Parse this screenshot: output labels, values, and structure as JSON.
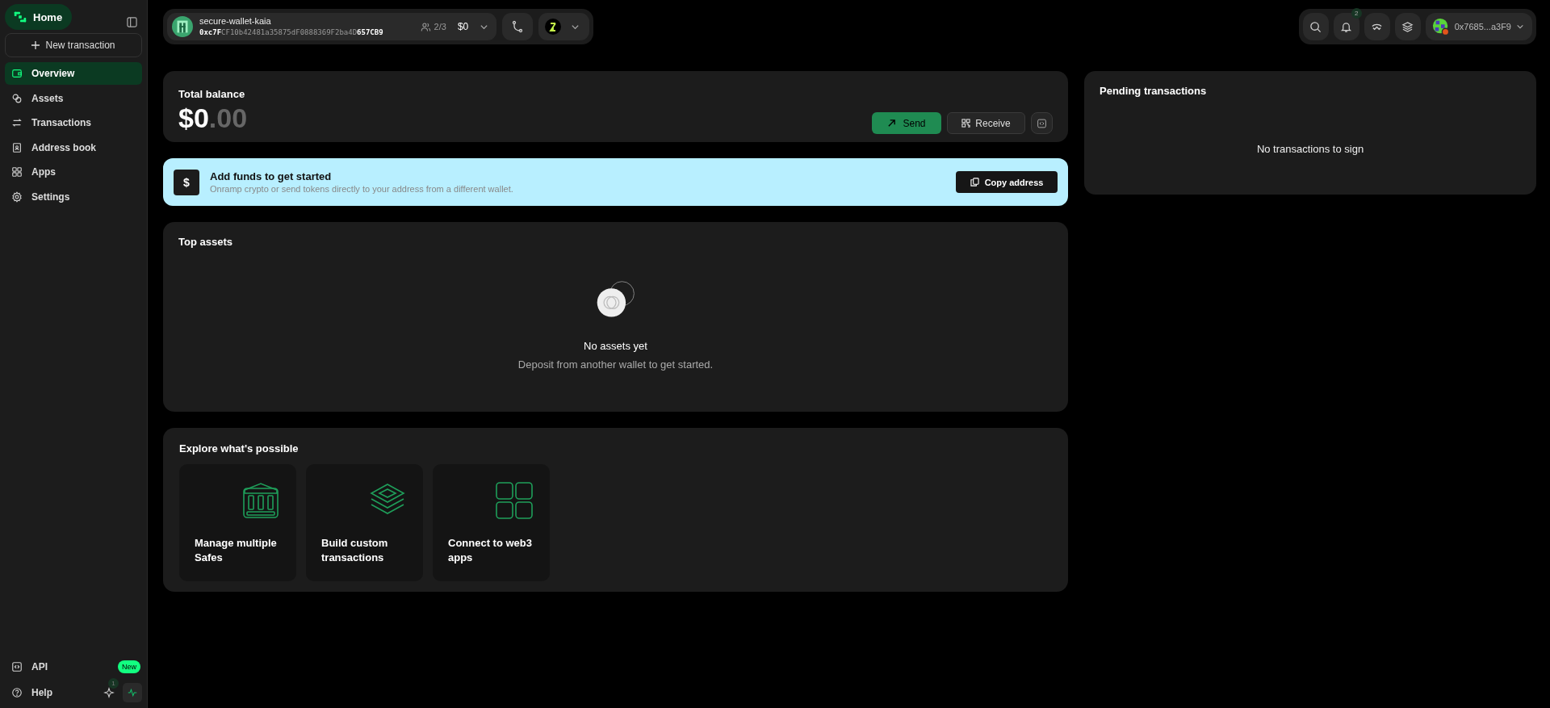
{
  "sidebar": {
    "home": "Home",
    "new_transaction": "New transaction",
    "items": [
      {
        "label": "Overview",
        "selected": true
      },
      {
        "label": "Assets",
        "selected": false
      },
      {
        "label": "Transactions",
        "selected": false
      },
      {
        "label": "Address book",
        "selected": false
      },
      {
        "label": "Apps",
        "selected": false
      },
      {
        "label": "Settings",
        "selected": false
      }
    ],
    "api": {
      "label": "API",
      "badge": "New"
    },
    "help": {
      "label": "Help",
      "badge": "1"
    }
  },
  "header": {
    "safe_name": "secure-wallet-kaia",
    "safe_address": "**0xc7F**CF10b42481a35875dF0888369F2ba4D**657CB9**",
    "threshold": "2/3",
    "balance": "$0",
    "notifications": "2",
    "account": "0x7685...a3F9"
  },
  "balance_card": {
    "title": "Total balance",
    "amount": "$0",
    "cents": ".00",
    "send": "Send",
    "receive": "Receive"
  },
  "banner": {
    "icon": "$",
    "title": "Add funds to get started",
    "text": "Onramp crypto or send tokens directly to your address from a different wallet.",
    "button": "Copy address"
  },
  "top_assets": {
    "title": "Top assets",
    "empty_title": "No assets yet",
    "empty_text": "Deposit from another wallet to get started."
  },
  "explore": {
    "title": "Explore what's possible",
    "cards": [
      {
        "label": "Manage multiple Safes"
      },
      {
        "label": "Build custom transactions"
      },
      {
        "label": "Connect to web3 apps"
      }
    ]
  },
  "pending": {
    "title": "Pending transactions",
    "empty": "No transactions to sign"
  }
}
